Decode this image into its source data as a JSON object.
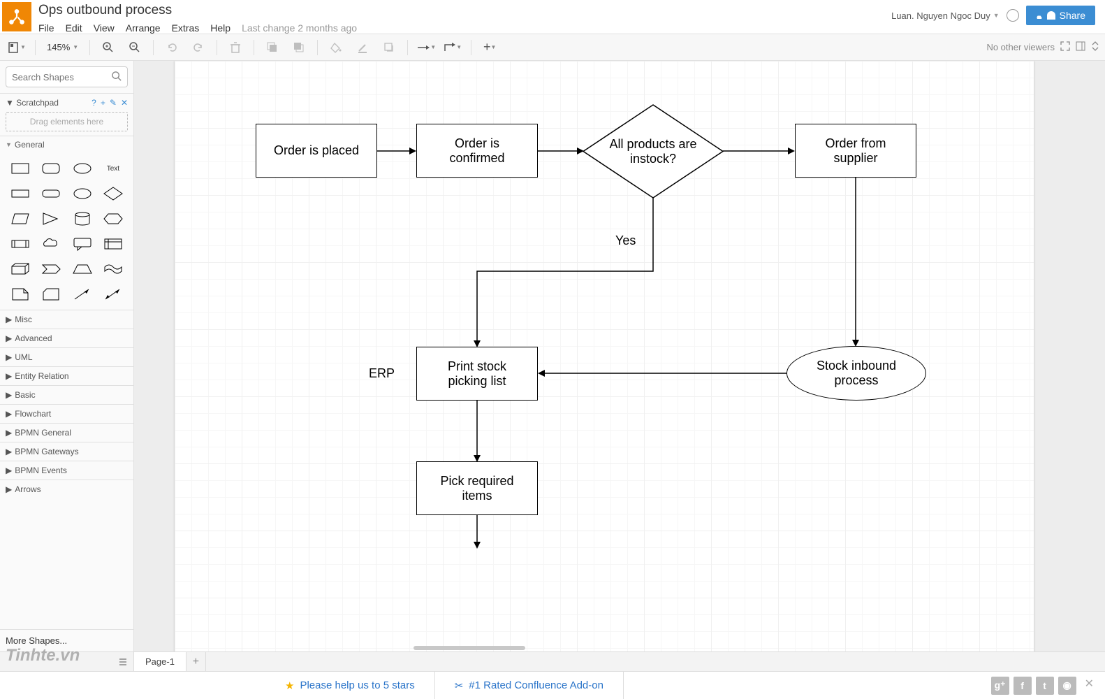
{
  "doc": {
    "title": "Ops outbound process",
    "last_change": "Last change 2 months ago"
  },
  "menu": {
    "file": "File",
    "edit": "Edit",
    "view": "View",
    "arrange": "Arrange",
    "extras": "Extras",
    "help": "Help"
  },
  "user": {
    "name": "Luan. Nguyen Ngoc Duy",
    "share": "Share"
  },
  "toolbar": {
    "zoom": "145%",
    "no_viewers": "No other viewers"
  },
  "left": {
    "search_placeholder": "Search Shapes",
    "scratchpad": {
      "label": "Scratchpad",
      "drop": "Drag elements here"
    },
    "general": "General",
    "text_label": "Text",
    "sections": [
      "Misc",
      "Advanced",
      "UML",
      "Entity Relation",
      "Basic",
      "Flowchart",
      "BPMN General",
      "BPMN Gateways",
      "BPMN Events",
      "Arrows"
    ],
    "more": "More Shapes..."
  },
  "canvas": {
    "erp_label": "ERP",
    "yes_label": "Yes",
    "nodes": {
      "order_placed": "Order is placed",
      "order_confirmed": "Order is\nconfirmed",
      "instock": "All products are\ninstock?",
      "order_supplier": "Order from\nsupplier",
      "print_list": "Print stock\npicking list",
      "inbound": "Stock inbound\nprocess",
      "pick_items": "Pick required\nitems"
    }
  },
  "tabs": {
    "page1": "Page-1"
  },
  "promo": {
    "a": "Please help us to 5 stars",
    "b": "#1 Rated Confluence Add-on"
  },
  "watermark": "Tinhte.vn"
}
